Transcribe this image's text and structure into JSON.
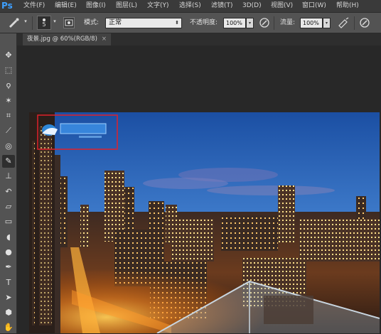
{
  "app": {
    "logo": "Ps"
  },
  "menu": [
    "文件(F)",
    "编辑(E)",
    "图像(I)",
    "图层(L)",
    "文字(Y)",
    "选择(S)",
    "滤镜(T)",
    "3D(D)",
    "视图(V)",
    "窗口(W)",
    "帮助(H)"
  ],
  "options": {
    "brush_size": "5",
    "mode_label": "模式:",
    "mode_value": "正常",
    "opacity_label": "不透明度:",
    "opacity_value": "100%",
    "flow_label": "流量:",
    "flow_value": "100%"
  },
  "document": {
    "tab_title": "夜景.jpg @ 60%(RGB/8)",
    "close": "×"
  },
  "tools": [
    "move-tool",
    "marquee-tool",
    "lasso-tool",
    "magic-wand-tool",
    "crop-tool",
    "eyedropper-tool",
    "healing-brush-tool",
    "brush-tool",
    "clone-stamp-tool",
    "history-brush-tool",
    "eraser-tool",
    "gradient-tool",
    "blur-tool",
    "dodge-tool",
    "pen-tool",
    "type-tool",
    "path-selection-tool",
    "shape-tool",
    "hand-tool"
  ],
  "colors": {
    "selection_box": "#e0202a",
    "ps_blue": "#3ea0ff"
  }
}
